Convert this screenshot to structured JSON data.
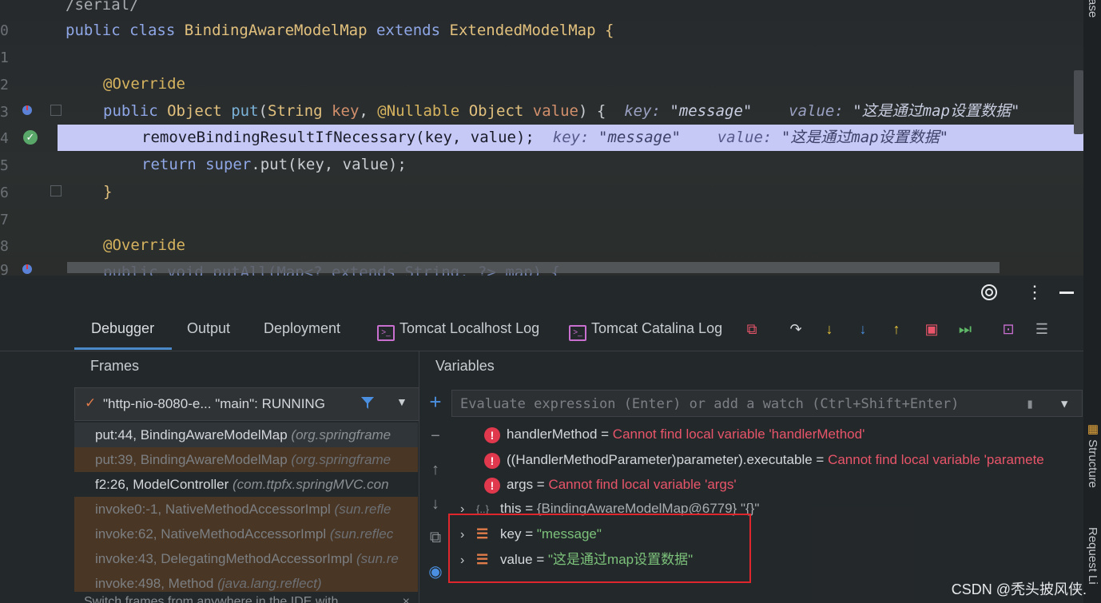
{
  "editor": {
    "line_numbers": [
      "0",
      "1",
      "2",
      "3",
      "4",
      "5",
      "6",
      "7",
      "8",
      "9"
    ],
    "lines": {
      "l0": "/serial/",
      "l1_kw1": "public",
      "l1_kw2": "class",
      "l1_cls": "BindingAwareModelMap",
      "l1_kw3": "extends",
      "l1_cls2": "ExtendedModelMap",
      "l1_brace": "{",
      "l3": "@Override",
      "l4_kw": "public",
      "l4_type": "Object",
      "l4_fn": "put",
      "l4_p1": "String",
      "l4_key": "key",
      "l4_ann": "@Nullable",
      "l4_p2": "Object",
      "l4_value": "value",
      "l4_end": ") {",
      "l4_hint1": "key:",
      "l4_hintval1": "\"message\"",
      "l4_hint2": "value:",
      "l4_hintval2": "\"这是通过map设置数据\"",
      "l5_code": "removeBindingResultIfNecessary(key, value);",
      "l5_hint1": "key:",
      "l5_hintval1": "\"message\"",
      "l5_hint2": "value:",
      "l5_hintval2": "\"这是通过map设置数据\"",
      "l6_kw": "return",
      "l6_super": "super",
      "l6_rest": ".put(key, value);",
      "l7": "}",
      "l9": "@Override",
      "l10": "public void putAll(Map<? extends String, ?> map) {"
    }
  },
  "side_tabs": {
    "top": "ase",
    "structure": "Structure",
    "request": "Request Li"
  },
  "tabs": [
    "Debugger",
    "Output",
    "Deployment",
    "Tomcat Localhost Log",
    "Tomcat Catalina Log"
  ],
  "panels": {
    "frames": "Frames",
    "variables": "Variables"
  },
  "thread": {
    "label": "\"http-nio-8080-e... \"main\": RUNNING"
  },
  "frames": [
    {
      "method": "put:44, BindingAwareModelMap",
      "pkg": "(org.springframe",
      "lib": false
    },
    {
      "method": "put:39, BindingAwareModelMap",
      "pkg": "(org.springframe",
      "lib": true
    },
    {
      "method": "f2:26, ModelController",
      "pkg": "(com.ttpfx.springMVC.con",
      "lib": false
    },
    {
      "method": "invoke0:-1, NativeMethodAccessorImpl",
      "pkg": "(sun.refle",
      "lib": true
    },
    {
      "method": "invoke:62, NativeMethodAccessorImpl",
      "pkg": "(sun.reflec",
      "lib": true
    },
    {
      "method": "invoke:43, DelegatingMethodAccessorImpl",
      "pkg": "(sun.re",
      "lib": true
    },
    {
      "method": "invoke:498, Method",
      "pkg": "(java.lang.reflect)",
      "lib": true
    }
  ],
  "frames_footer": "Switch frames from anywhere in the IDE with",
  "eval": {
    "placeholder": "Evaluate expression (Enter) or add a watch (Ctrl+Shift+Enter)"
  },
  "variables": [
    {
      "name": "handlerMethod",
      "eq": " = ",
      "val": "Cannot find local variable 'handlerMethod'"
    },
    {
      "name": "((HandlerMethodParameter)parameter).executable",
      "eq": " = ",
      "val": "Cannot find local variable 'paramete"
    },
    {
      "name": "args",
      "eq": " = ",
      "val": "Cannot find local variable 'args'"
    },
    {
      "name": "this",
      "eq": " = ",
      "val": "{BindingAwareModelMap@6779} \"{}\""
    },
    {
      "name": "key",
      "eq": " = ",
      "val": "\"message\""
    },
    {
      "name": "value",
      "eq": " = ",
      "val": "\"这是通过map设置数据\""
    }
  ],
  "watermark": "CSDN @秃头披风侠."
}
